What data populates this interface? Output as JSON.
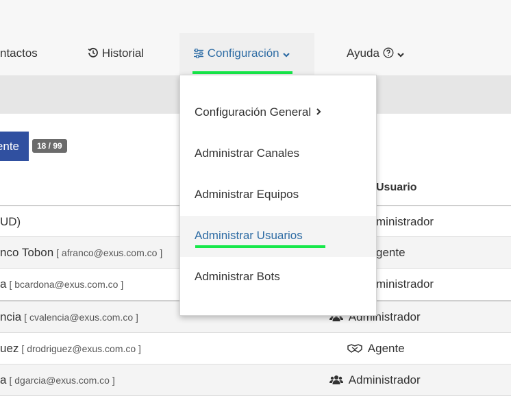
{
  "nav": {
    "contactos": "ntactos",
    "historial": "Historial",
    "configuracion": "Configuración",
    "ayuda": "Ayuda"
  },
  "agent_button": "ente",
  "badge": "18 / 99",
  "table": {
    "role_header": "Usuario",
    "rows": [
      {
        "name": "UD)",
        "email": "",
        "role": "ministrador"
      },
      {
        "name": "nco Tobon",
        "email": "[ afranco@exus.com.co ]",
        "role": "gente"
      },
      {
        "name": "a",
        "email": "[ bcardona@exus.com.co ]",
        "role": "ministrador"
      },
      {
        "name": "ncia",
        "email": "[ cvalencia@exus.com.co ]",
        "role": "Administrador"
      },
      {
        "name": "uez",
        "email": "[ drodriguez@exus.com.co ]",
        "role": "Agente"
      },
      {
        "name": "a",
        "email": "[ dgarcia@exus.com.co ]",
        "role": "Administrador"
      }
    ]
  },
  "dropdown": {
    "items": [
      {
        "label": "Configuración General"
      },
      {
        "label": "Administrar Canales"
      },
      {
        "label": "Administrar Equipos"
      },
      {
        "label": "Administrar Usuarios"
      },
      {
        "label": "Administrar Bots"
      }
    ]
  },
  "colors": {
    "accent": "#2e6ca4",
    "highlight": "#17e84a",
    "button": "#3050a0"
  }
}
